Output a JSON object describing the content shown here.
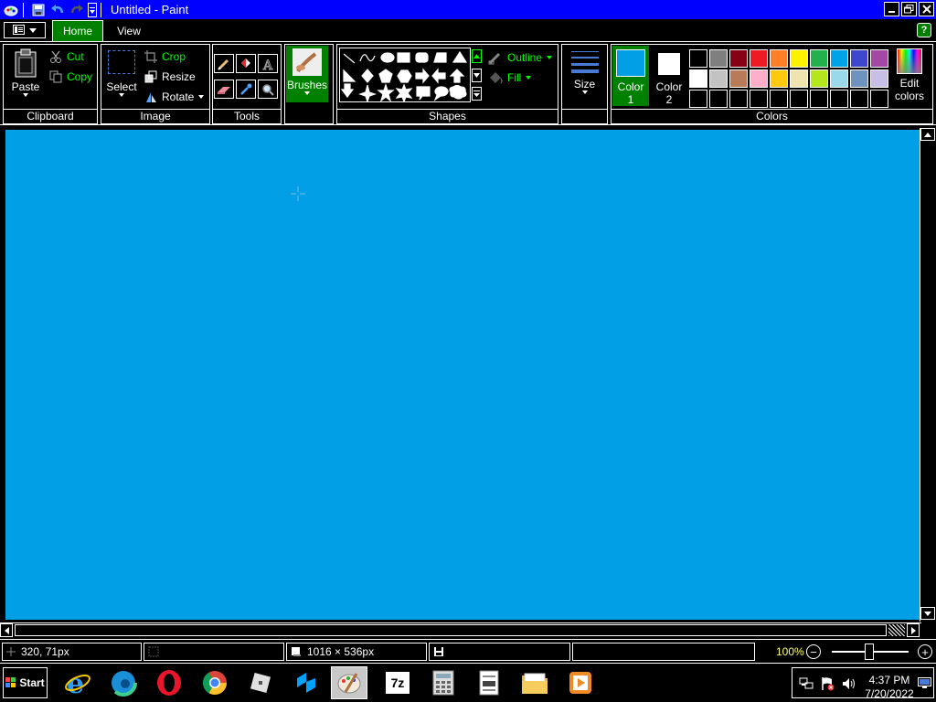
{
  "window": {
    "title": "Untitled - Paint",
    "title_bg": "#0000ff"
  },
  "tabs": {
    "home": "Home",
    "view": "View",
    "active_color": "#008000"
  },
  "ribbon": {
    "clipboard": {
      "paste": "Paste",
      "cut": "Cut",
      "copy": "Copy",
      "label": "Clipboard"
    },
    "image": {
      "select": "Select",
      "crop": "Crop",
      "resize": "Resize",
      "rotate": "Rotate",
      "label": "Image"
    },
    "tools": {
      "label": "Tools"
    },
    "brushes": {
      "label": "Brushes"
    },
    "shapes": {
      "outline": "Outline",
      "fill": "Fill",
      "label": "Shapes"
    },
    "size": {
      "label": "Size"
    },
    "colors": {
      "color1": "Color",
      "color1_num": "1",
      "color2": "Color",
      "color2_num": "2",
      "edit": "Edit",
      "edit2": "colors",
      "label": "Colors",
      "color1_value": "#009fe6",
      "color2_value": "#ffffff",
      "palette_row1": [
        "#000000",
        "#7f7f7f",
        "#880015",
        "#ed1c24",
        "#ff7f27",
        "#fff200",
        "#22b14c",
        "#00a2e8",
        "#3f48cc",
        "#a349a4"
      ],
      "palette_row2": [
        "#ffffff",
        "#c3c3c3",
        "#b97a57",
        "#ffaec9",
        "#ffc90e",
        "#efe4b0",
        "#b5e61d",
        "#99d9ea",
        "#7092be",
        "#c8bfe7"
      ]
    }
  },
  "canvas": {
    "background": "#009fe6"
  },
  "statusbar": {
    "cursor_pos": "320, 71px",
    "canvas_size": "1016 × 536px",
    "zoom": "100%"
  },
  "taskbar": {
    "start": "Start",
    "time": "4:37 PM",
    "date": "7/20/2022"
  }
}
